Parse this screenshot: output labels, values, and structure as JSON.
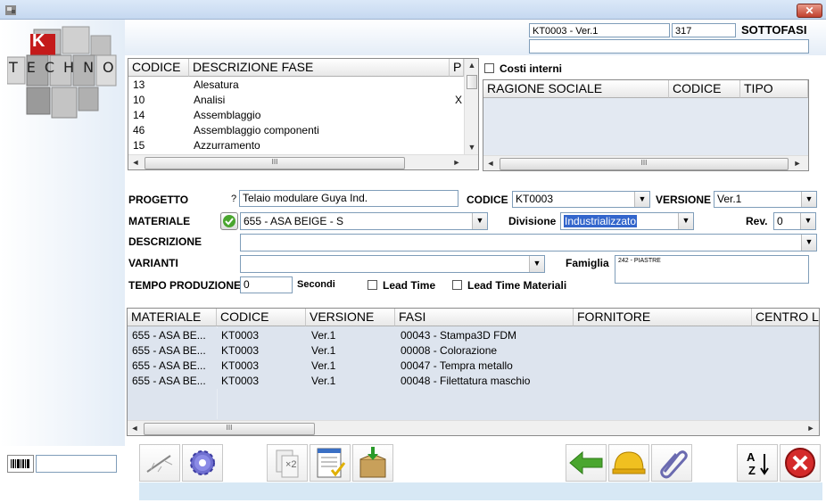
{
  "window": {
    "close_label": "✕"
  },
  "header": {
    "code_field": "KT0003 - Ver.1",
    "number_field": "317",
    "title": "SOTTOFASI",
    "sub_field": ""
  },
  "logo": {
    "line1": "K",
    "line2": "TECHNO"
  },
  "phases": {
    "columns": [
      "CODICE",
      "DESCRIZIONE FASE",
      "P"
    ],
    "rows": [
      {
        "code": "13",
        "desc": "Alesatura",
        "p": ""
      },
      {
        "code": "10",
        "desc": "Analisi",
        "p": "X"
      },
      {
        "code": "14",
        "desc": "Assemblaggio",
        "p": ""
      },
      {
        "code": "46",
        "desc": "Assemblaggio componenti",
        "p": ""
      },
      {
        "code": "15",
        "desc": "Azzurramento",
        "p": ""
      }
    ],
    "thumb_label": "III"
  },
  "costi": {
    "label": "Costi interni",
    "columns": [
      "RAGIONE SOCIALE",
      "CODICE",
      "TIPO"
    ],
    "thumb_label": "III"
  },
  "form": {
    "progetto_label": "PROGETTO",
    "progetto_q": "?",
    "progetto_value": "Telaio modulare Guya Ind.",
    "codice_label": "CODICE",
    "codice_value": "KT0003",
    "versione_label": "VERSIONE",
    "versione_value": "Ver.1",
    "materiale_label": "MATERIALE",
    "materiale_value": "655 - ASA BEIGE - S",
    "divisione_label": "Divisione",
    "divisione_value": "Industrializzato",
    "rev_label": "Rev.",
    "rev_value": "0",
    "descrizione_label": "DESCRIZIONE",
    "descrizione_value": "",
    "varianti_label": "VARIANTI",
    "varianti_value": "",
    "famiglia_label": "Famiglia",
    "famiglia_value": "242 - PIASTRE",
    "tempo_label": "TEMPO PRODUZIONE",
    "tempo_value": "0",
    "secondi_label": "Secondi",
    "lead_time_label": "Lead Time",
    "lead_time_mat_label": "Lead Time Materiali"
  },
  "materials": {
    "columns": [
      "MATERIALE",
      "CODICE",
      "VERSIONE",
      "FASI",
      "FORNITORE",
      "CENTRO LA"
    ],
    "rows": [
      {
        "mat": "655 - ASA BE...",
        "code": "KT0003",
        "ver": "Ver.1",
        "fase": "00043 - Stampa3D FDM"
      },
      {
        "mat": "655 - ASA BE...",
        "code": "KT0003",
        "ver": "Ver.1",
        "fase": "00008 - Colorazione"
      },
      {
        "mat": "655 - ASA BE...",
        "code": "KT0003",
        "ver": "Ver.1",
        "fase": "00047 - Tempra metallo"
      },
      {
        "mat": "655 - ASA BE...",
        "code": "KT0003",
        "ver": "Ver.1",
        "fase": "00048 - Filettatura maschio"
      }
    ],
    "thumb_label": "III"
  },
  "toolbar": {
    "barcode_value": "",
    "x2_label": "×2",
    "sort_a": "A",
    "sort_z": "Z"
  },
  "colors": {
    "accent": "#3366cc",
    "close_red": "#c0402e",
    "sel": "#dde4ee",
    "green_arrow": "#4aa62e"
  }
}
